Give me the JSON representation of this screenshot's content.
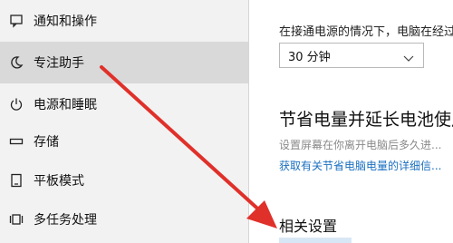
{
  "sidebar": {
    "items": [
      {
        "label": "通知和操作",
        "icon": "notification-icon"
      },
      {
        "label": "专注助手",
        "icon": "moon-icon",
        "active": true
      },
      {
        "label": "电源和睡眠",
        "icon": "power-icon"
      },
      {
        "label": "存储",
        "icon": "storage-icon"
      },
      {
        "label": "平板模式",
        "icon": "tablet-icon"
      },
      {
        "label": "多任务处理",
        "icon": "multitask-icon"
      }
    ]
  },
  "main": {
    "plugged_in_text": "在接通电源的情况下，电脑在经过",
    "dropdown_value": "30 分钟",
    "section_title": "节省电量并延长电池使用",
    "section_desc": "设置屏幕在你离开电脑后多久进...",
    "section_link": "获取有关节省电脑电量的详细信...",
    "related_title": "相关设置"
  },
  "colors": {
    "arrow": "#e0302a",
    "link": "#1a6fc0",
    "sidebar_bg": "#f2f2f2",
    "active_bg": "#d9d9d9"
  }
}
